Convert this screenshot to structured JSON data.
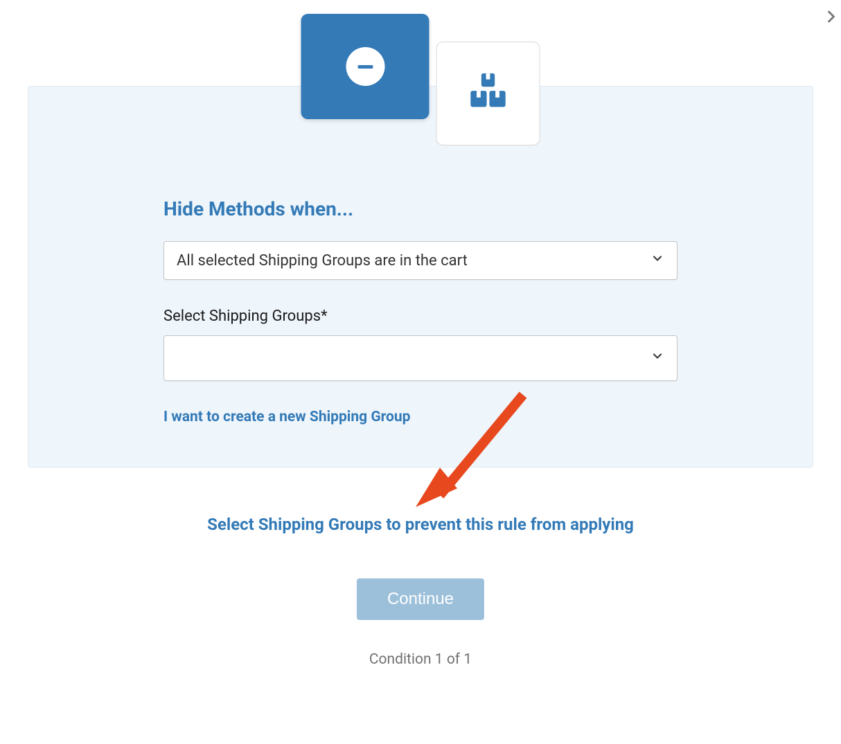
{
  "heading": "Hide Methods when...",
  "condition_select": {
    "selected": "All selected Shipping Groups are in the cart"
  },
  "groups_field": {
    "label": "Select Shipping Groups*",
    "selected": ""
  },
  "create_link": "I want to create a new Shipping Group",
  "prevent_link": "Select Shipping Groups to prevent this rule from applying",
  "continue_button": "Continue",
  "condition_counter": "Condition 1 of 1"
}
